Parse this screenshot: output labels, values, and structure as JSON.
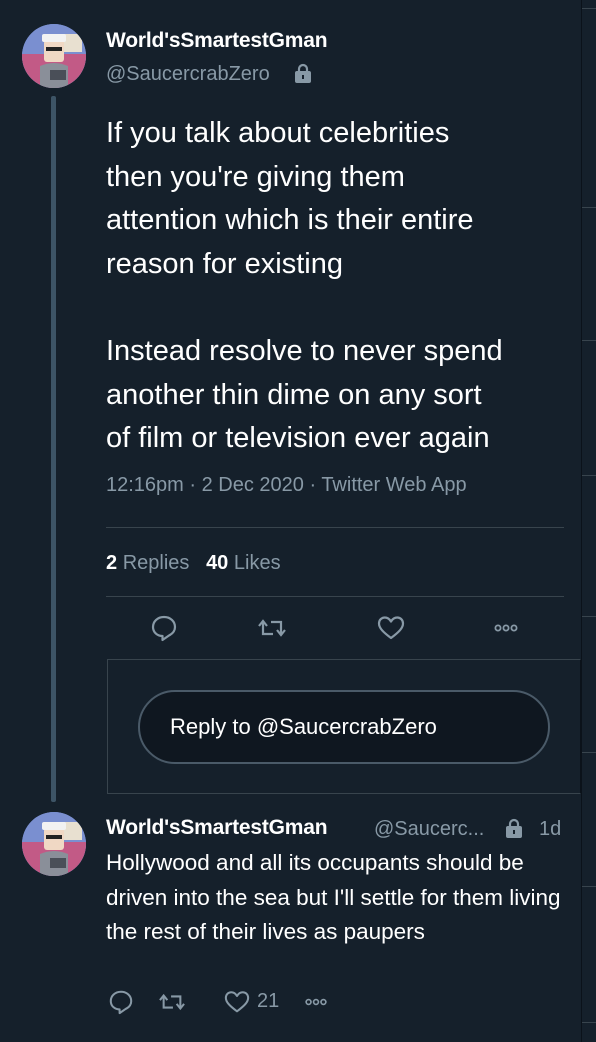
{
  "main_tweet": {
    "display_name": "World'sSmartestGman",
    "handle": "@SaucercrabZero",
    "lock_icon": "lock-icon",
    "text": "If you talk about celebrities\nthen you're giving them\nattention which is their entire\nreason for existing\n\nInstead resolve to never spend\nanother thin dime on any sort\nof film or television ever again",
    "timestamp": "12:16pm · 2 Dec 2020 · Twitter Web App",
    "replies_count": "2",
    "replies_label": "Replies",
    "likes_count": "40",
    "likes_label": "Likes",
    "actions": [
      "reply-icon",
      "retweet-icon",
      "heart-icon",
      "more-icon"
    ]
  },
  "reply_composer": {
    "button_label": "Reply to @SaucercrabZero"
  },
  "reply_tweet": {
    "display_name": "World'sSmartestGman",
    "handle": "@Saucerc...",
    "time": "1d",
    "text": "Hollywood and all its occupants should be driven into the sea but I'll settle for them living the rest of their lives as paupers",
    "like_count": "21",
    "actions": [
      "reply-icon",
      "retweet-icon",
      "heart-icon",
      "more-icon"
    ]
  },
  "colors": {
    "background": "#15202b",
    "secondary_text": "#8899a6",
    "border": "#38444d",
    "thread_line": "#3d5466"
  }
}
